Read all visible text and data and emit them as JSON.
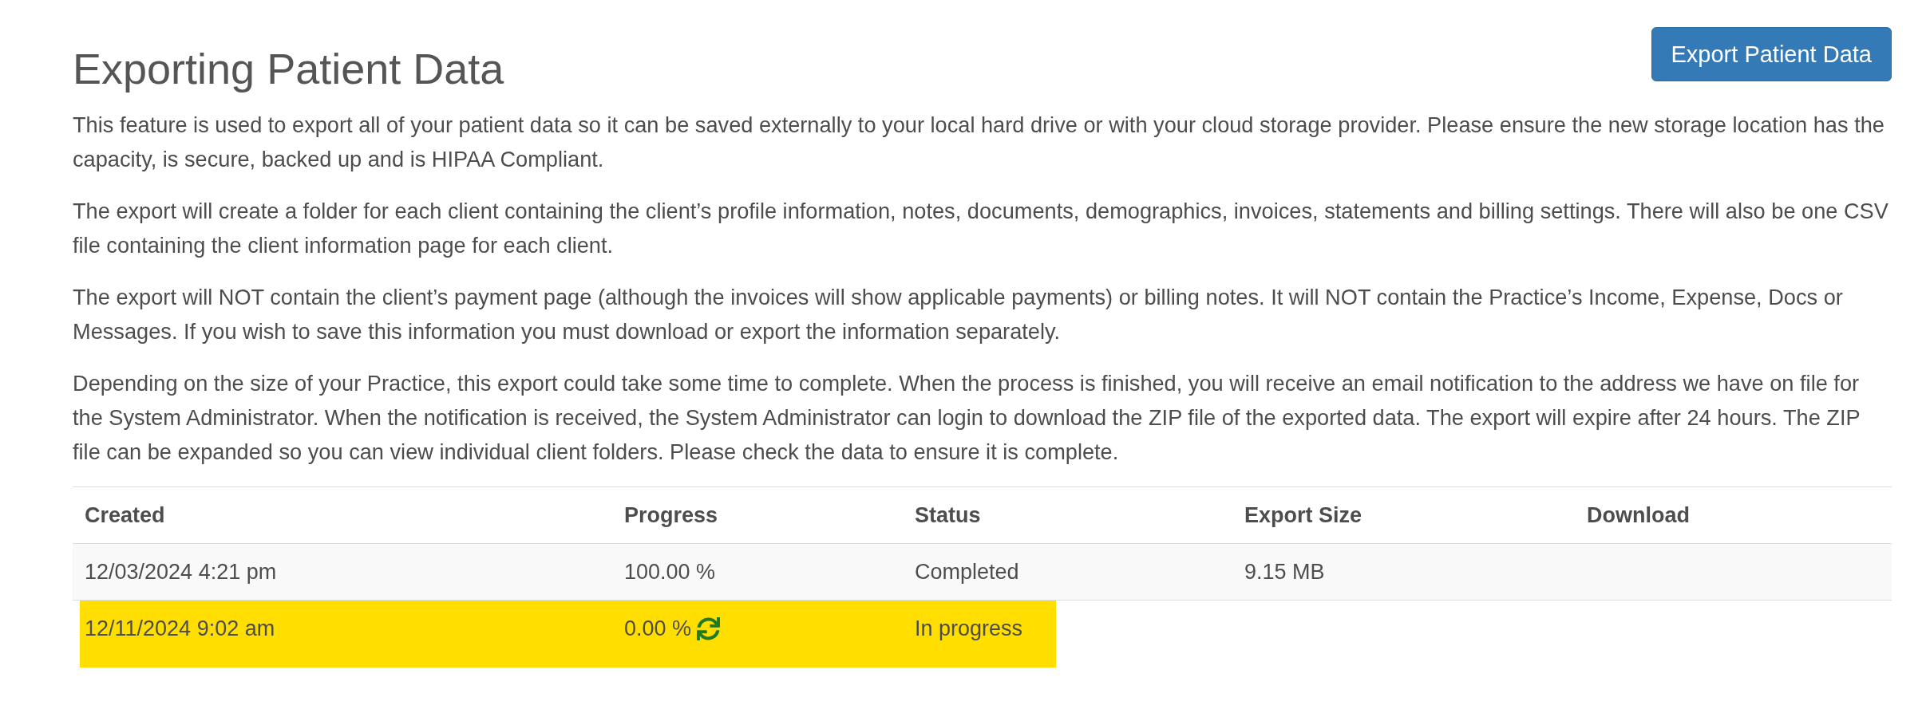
{
  "page": {
    "title": "Exporting Patient Data",
    "export_button": "Export Patient Data"
  },
  "paragraphs": [
    "This feature is used to export all of your patient data so it can be saved externally to your local hard drive or with your cloud storage provider. Please ensure the new storage location has the capacity, is secure, backed up and is HIPAA Compliant.",
    "The export will create a folder for each client containing the client’s profile information, notes, documents, demographics, invoices, statements and billing settings. There will also be one CSV file containing the client information page for each client.",
    "The export will NOT contain the client’s payment page (although the invoices will show applicable payments) or billing notes. It will NOT contain the Practice’s Income, Expense, Docs or Messages. If you wish to save this information you must download or export the information separately.",
    "Depending on the size of your Practice, this export could take some time to complete. When the process is finished, you will receive an email notification to the address we have on file for the System Administrator. When the notification is received, the System Administrator can login to download the ZIP file of the exported data. The export will expire after 24 hours. The ZIP file can be expanded so you can view individual client folders. Please check the data to ensure it is complete."
  ],
  "table": {
    "columns": [
      "Created",
      "Progress",
      "Status",
      "Export Size",
      "Download"
    ],
    "rows": [
      {
        "created": "12/03/2024 4:21 pm",
        "progress": "100.00 %",
        "status": "Completed",
        "export_size": "9.15 MB",
        "in_progress": false,
        "highlighted": false
      },
      {
        "created": "12/11/2024 9:02 am",
        "progress": "0.00 %",
        "status": "In progress",
        "in_progress": true,
        "highlighted": true
      }
    ]
  }
}
